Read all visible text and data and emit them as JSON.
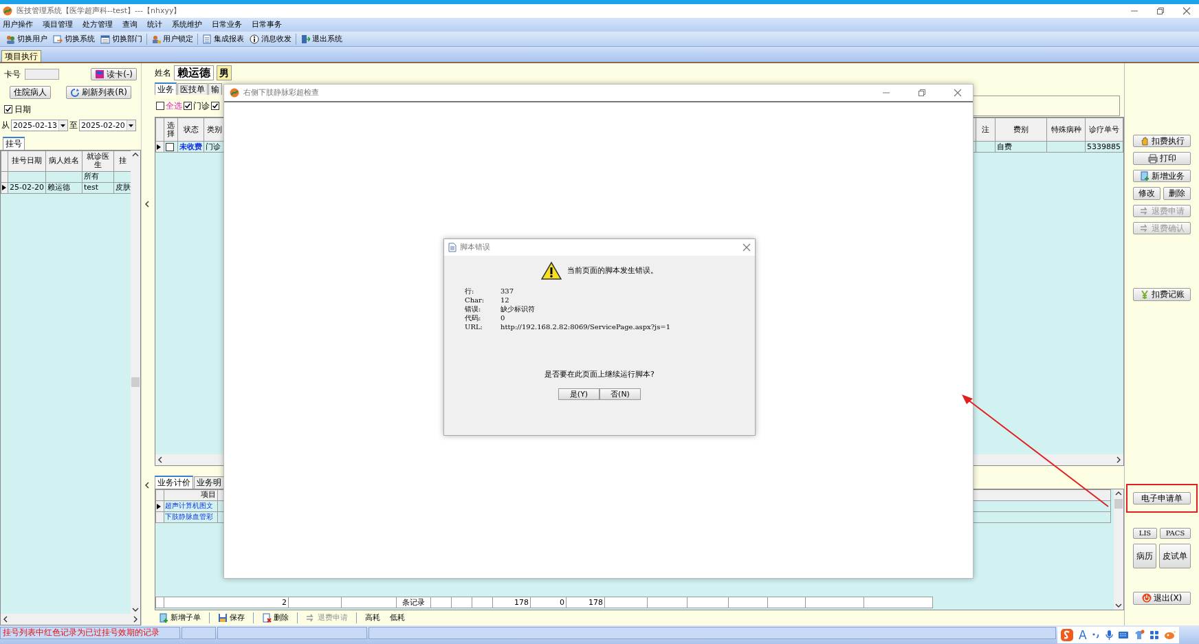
{
  "window": {
    "title": "医技管理系统【医学超声科--test】---【nhxyy】"
  },
  "menu": [
    "用户操作",
    "项目管理",
    "处方管理",
    "查询",
    "统计",
    "系统维护",
    "日常业务",
    "日常事务"
  ],
  "toolbar": [
    "切换用户",
    "切换系统",
    "切换部门",
    "用户锁定",
    "集成报表",
    "消息收发",
    "退出系统"
  ],
  "module_tabs": [
    {
      "label": "项目执行",
      "selected": true
    }
  ],
  "left_panel": {
    "card_label": "卡号",
    "read_card_button": "读卡(-)",
    "inpatient_button": "住院病人",
    "refresh_button": "刷新列表(R)",
    "date_filter": {
      "label": "日期",
      "checked": true
    },
    "from_label": "从",
    "from_date": "2025-02-13",
    "to_label": "至",
    "to_date": "2025-02-20",
    "tabs": [
      {
        "label": "挂号",
        "selected": true
      }
    ],
    "columns": [
      {
        "label": "挂号日期"
      },
      {
        "label": "病人姓名"
      },
      {
        "label": "就诊医生",
        "filter": "所有"
      },
      {
        "label": "挂"
      }
    ],
    "rows": [
      {
        "cells": [
          "25-02-20",
          "赖运德",
          "test",
          "皮肤"
        ],
        "current": true
      }
    ]
  },
  "patient": {
    "name_label": "姓名",
    "name": "赖运德",
    "sex": "男"
  },
  "business_tabs": [
    {
      "label": "业务",
      "selected": true
    },
    {
      "label": "医技单",
      "selected": false
    },
    {
      "label": "输",
      "selected": false
    }
  ],
  "filters": [
    {
      "label": "全选",
      "checked": false
    },
    {
      "label": "门诊",
      "checked": true
    },
    {
      "checked": true
    }
  ],
  "business_table": {
    "columns_left": [
      "选择",
      "状态",
      "类别"
    ],
    "columns_right": [
      "注",
      "费别",
      "特殊病种",
      "诊疗单号"
    ],
    "rows": [
      {
        "checked": false,
        "current": true,
        "status": "未收费",
        "category": "门诊",
        "fee_type": "自费",
        "order_no": "5339885"
      }
    ]
  },
  "detail_tabs": [
    {
      "label": "业务计价",
      "selected": true
    },
    {
      "label": "业务明",
      "selected": false
    }
  ],
  "detail_table": {
    "column": "项目",
    "rows": [
      {
        "item": "超声计算机图文",
        "current": true
      },
      {
        "item": "下肢静脉血管彩",
        "current": false
      }
    ],
    "footer": {
      "count": "2",
      "count_label": "条记录",
      "totals": [
        "178",
        "0",
        "178"
      ]
    }
  },
  "bottom_toolbar": [
    {
      "label": "新增子单",
      "disabled": false
    },
    {
      "label": "保存",
      "disabled": false
    },
    {
      "label": "删除",
      "disabled": false
    },
    {
      "label": "退费申请",
      "disabled": true
    },
    {
      "label": "高耗",
      "disabled": false
    },
    {
      "label": "低耗",
      "disabled": false
    }
  ],
  "side_groups": [
    [
      [
        {
          "label": "扣费执行",
          "disabled": false,
          "annotated": false
        }
      ],
      [
        {
          "label": "打印",
          "disabled": false,
          "annotated": false
        }
      ],
      [
        {
          "label": "新增业务",
          "disabled": false,
          "annotated": false
        }
      ],
      [
        {
          "label": "修改",
          "disabled": false,
          "annotated": false
        },
        {
          "label": "删除",
          "disabled": false,
          "annotated": false
        }
      ],
      [
        {
          "label": "退费申请",
          "disabled": true,
          "annotated": false
        }
      ],
      [
        {
          "label": "退费确认",
          "disabled": true,
          "annotated": false
        }
      ]
    ],
    [
      [
        {
          "label": "扣费记账",
          "disabled": false,
          "annotated": false
        }
      ]
    ],
    [
      [
        {
          "label": "电子申请单",
          "disabled": false,
          "annotated": true
        }
      ]
    ],
    [
      [
        {
          "label": "LIS",
          "disabled": false,
          "annotated": false
        },
        {
          "label": "PACS",
          "disabled": false,
          "annotated": false
        }
      ],
      [
        {
          "label": "病历",
          "disabled": false,
          "annotated": false
        },
        {
          "label": "皮试单",
          "disabled": false,
          "annotated": false
        }
      ]
    ],
    [
      [
        {
          "label": "退出(X)",
          "disabled": false,
          "annotated": false
        }
      ]
    ]
  ],
  "popup_window": {
    "title": "右侧下肢静脉彩超检查"
  },
  "error_dialog": {
    "title": "脚本错误",
    "message": "当前页面的脚本发生错误。",
    "details": [
      {
        "label": "行:",
        "value": "337"
      },
      {
        "label": "Char:",
        "value": "12"
      },
      {
        "label": "错误:",
        "value": "缺少标识符"
      },
      {
        "label": "代码:",
        "value": "0"
      },
      {
        "label": "URL:",
        "value": "http://192.168.2.82:8069/ServicePage.aspx?js=1"
      }
    ],
    "question": "是否要在此页面上继续运行脚本?",
    "buttons": [
      "是(Y)",
      "否(N)"
    ]
  },
  "status_bar": {
    "message": "挂号列表中红色记录为已过挂号效期的记录"
  },
  "ime_bar": {
    "label": "A"
  }
}
